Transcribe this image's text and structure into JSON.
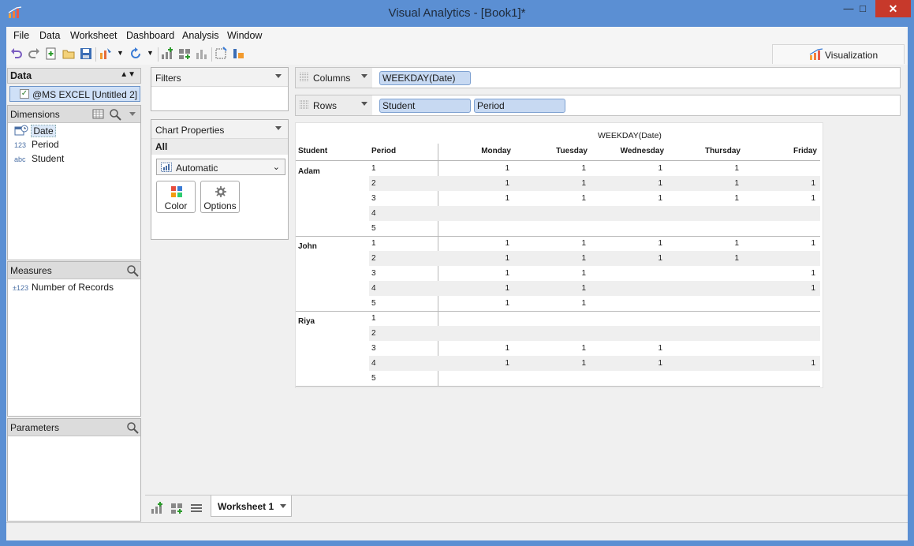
{
  "window": {
    "title": "Visual Analytics - [Book1]*"
  },
  "menu": [
    "File",
    "Data",
    "Worksheet",
    "Dashboard",
    "Analysis",
    "Window"
  ],
  "visualization_tab": "Visualization",
  "data_panel": {
    "header": "Data",
    "datasource": "@MS EXCEL [Untitled 2]",
    "dimensions_label": "Dimensions",
    "dimensions": [
      {
        "type": "",
        "name": "Date"
      },
      {
        "type": "123",
        "name": "Period"
      },
      {
        "type": "abc",
        "name": "Student"
      }
    ],
    "measures_label": "Measures",
    "measures": [
      {
        "type": "±123",
        "name": "Number of Records"
      }
    ],
    "parameters_label": "Parameters"
  },
  "filters": {
    "label": "Filters"
  },
  "chart_properties": {
    "label": "Chart Properties",
    "all_label": "All",
    "mark_type": "Automatic",
    "color_label": "Color",
    "options_label": "Options"
  },
  "shelves": {
    "columns_label": "Columns",
    "columns": [
      "WEEKDAY(Date)"
    ],
    "rows_label": "Rows",
    "rows": [
      "Student",
      "Period"
    ]
  },
  "crosstab": {
    "column_header": "WEEKDAY(Date)",
    "row_headers": [
      "Student",
      "Period"
    ],
    "days": [
      "Monday",
      "Tuesday",
      "Wednesday",
      "Thursday",
      "Friday"
    ],
    "groups": [
      {
        "student": "Adam",
        "rows": [
          {
            "period": "1",
            "values": [
              "1",
              "1",
              "1",
              "1",
              ""
            ]
          },
          {
            "period": "2",
            "values": [
              "1",
              "1",
              "1",
              "1",
              "1"
            ]
          },
          {
            "period": "3",
            "values": [
              "1",
              "1",
              "1",
              "1",
              "1"
            ]
          },
          {
            "period": "4",
            "values": [
              "",
              "",
              "",
              "",
              ""
            ]
          },
          {
            "period": "5",
            "values": [
              "",
              "",
              "",
              "",
              ""
            ]
          }
        ]
      },
      {
        "student": "John",
        "rows": [
          {
            "period": "1",
            "values": [
              "1",
              "1",
              "1",
              "1",
              "1"
            ]
          },
          {
            "period": "2",
            "values": [
              "1",
              "1",
              "1",
              "1",
              ""
            ]
          },
          {
            "period": "3",
            "values": [
              "1",
              "1",
              "",
              "",
              "1"
            ]
          },
          {
            "period": "4",
            "values": [
              "1",
              "1",
              "",
              "",
              "1"
            ]
          },
          {
            "period": "5",
            "values": [
              "1",
              "1",
              "",
              "",
              ""
            ]
          }
        ]
      },
      {
        "student": "Riya",
        "rows": [
          {
            "period": "1",
            "values": [
              "",
              "",
              "",
              "",
              ""
            ]
          },
          {
            "period": "2",
            "values": [
              "",
              "",
              "",
              "",
              ""
            ]
          },
          {
            "period": "3",
            "values": [
              "1",
              "1",
              "1",
              "",
              ""
            ]
          },
          {
            "period": "4",
            "values": [
              "1",
              "1",
              "1",
              "",
              "1"
            ]
          },
          {
            "period": "5",
            "values": [
              "",
              "",
              "",
              "",
              ""
            ]
          }
        ]
      }
    ]
  },
  "sheet_tabs": [
    "Worksheet 1"
  ]
}
